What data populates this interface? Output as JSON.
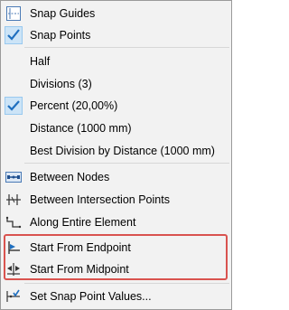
{
  "menu": {
    "items": [
      {
        "label": "Snap Guides",
        "icon": "snap-guides-icon"
      },
      {
        "label": "Snap Points",
        "icon": "check-icon",
        "checked": true
      },
      {
        "label": "Half"
      },
      {
        "label": "Divisions (3)"
      },
      {
        "label": "Percent (20,00%)",
        "checked": true
      },
      {
        "label": "Distance (1000 mm)"
      },
      {
        "label": "Best Division by Distance (1000 mm)"
      },
      {
        "label": "Between Nodes",
        "icon": "between-nodes-icon"
      },
      {
        "label": "Between Intersection Points",
        "icon": "intersection-points-icon"
      },
      {
        "label": "Along Entire Element",
        "icon": "along-element-icon"
      },
      {
        "label": "Start From Endpoint",
        "icon": "endpoint-icon"
      },
      {
        "label": "Start From Midpoint",
        "icon": "midpoint-icon"
      },
      {
        "label": "Set Snap Point Values...",
        "icon": "snap-values-icon"
      }
    ]
  },
  "colors": {
    "menu_bg": "#f2f2f2",
    "check_blue": "#1f6fbf",
    "highlight_box": "#d9534f"
  }
}
